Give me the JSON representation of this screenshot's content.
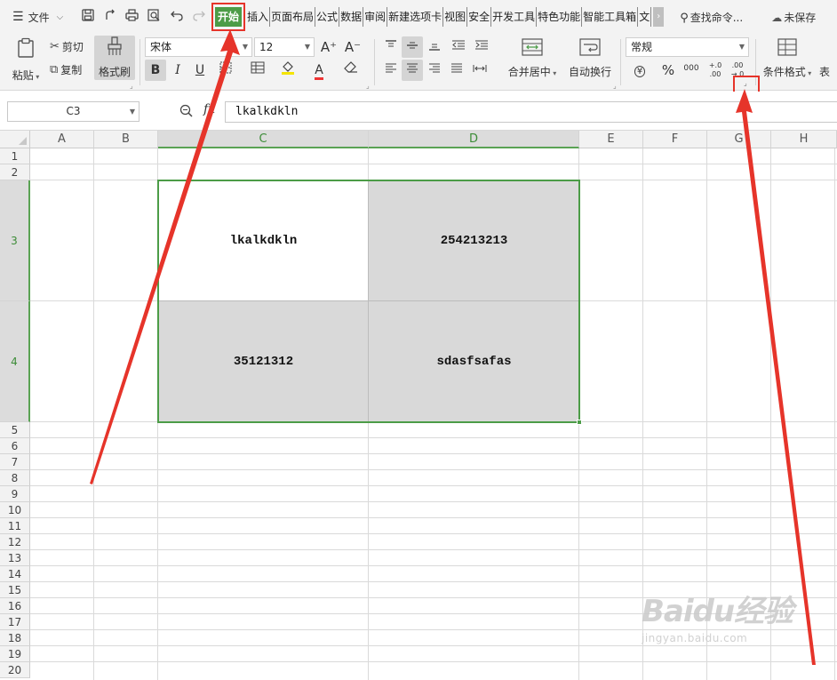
{
  "menubar": {
    "menu_label": "文件",
    "quick_access": [
      {
        "icon": "save-icon",
        "glyph": "🖫"
      },
      {
        "icon": "share-icon",
        "glyph": "⇪"
      },
      {
        "icon": "print-icon",
        "glyph": "⎙"
      },
      {
        "icon": "print-preview-icon",
        "glyph": "🔍"
      },
      {
        "icon": "undo-icon",
        "glyph": "↶"
      },
      {
        "icon": "redo-icon",
        "glyph": "↷"
      }
    ],
    "tabs": [
      "插入",
      "页面布局",
      "公式",
      "数据",
      "审阅",
      "新建选项卡",
      "视图",
      "安全",
      "开发工具",
      "特色功能",
      "智能工具箱",
      "文"
    ],
    "active_tab": "开始",
    "more_glyph": "›",
    "search_label": "查找命令...",
    "save_status": "未保存"
  },
  "ribbon": {
    "paste_label": "粘贴",
    "cut_label": "剪切",
    "copy_label": "复制",
    "format_painter_label": "格式刷",
    "font_name": "宋体",
    "font_size": "12",
    "grow_font": "A⁺",
    "shrink_font": "A⁻",
    "bold": "B",
    "italic": "I",
    "underline": "U",
    "font_color_letter": "A",
    "merge_label": "合并居中",
    "wrap_label": "自动换行",
    "number_format": "常规",
    "currency_glyph": "¥",
    "percent_glyph": "%",
    "thousands_glyph": "000",
    "inc_decimal": "+.0 .00",
    "dec_decimal": ".00 →.0",
    "conditional_format_label": "条件格式",
    "table_style_label": "表"
  },
  "formula_bar": {
    "name_box": "C3",
    "fx_label": "fx",
    "formula": "lkalkdkln"
  },
  "sheet": {
    "columns": [
      "A",
      "B",
      "C",
      "D",
      "E",
      "F",
      "G",
      "H"
    ],
    "rows": [
      "1",
      "2",
      "3",
      "4",
      "5",
      "6",
      "7",
      "8",
      "9",
      "10",
      "11",
      "12",
      "13",
      "14",
      "15",
      "16",
      "17",
      "18",
      "19",
      "20"
    ],
    "selected_columns": [
      "C",
      "D"
    ],
    "selected_rows": [
      "3",
      "4"
    ],
    "cells": {
      "C3": "lkalkdkln",
      "D3": "254213213",
      "C4": "35121312",
      "D4": "sdasfsafas"
    }
  },
  "watermark": {
    "brand": "Baidu经验",
    "url": "jingyan.baidu.com"
  },
  "colors": {
    "accent_green": "#4c9c47",
    "annotation_red": "#e6342a",
    "cell_gray": "#d9d9d9"
  }
}
